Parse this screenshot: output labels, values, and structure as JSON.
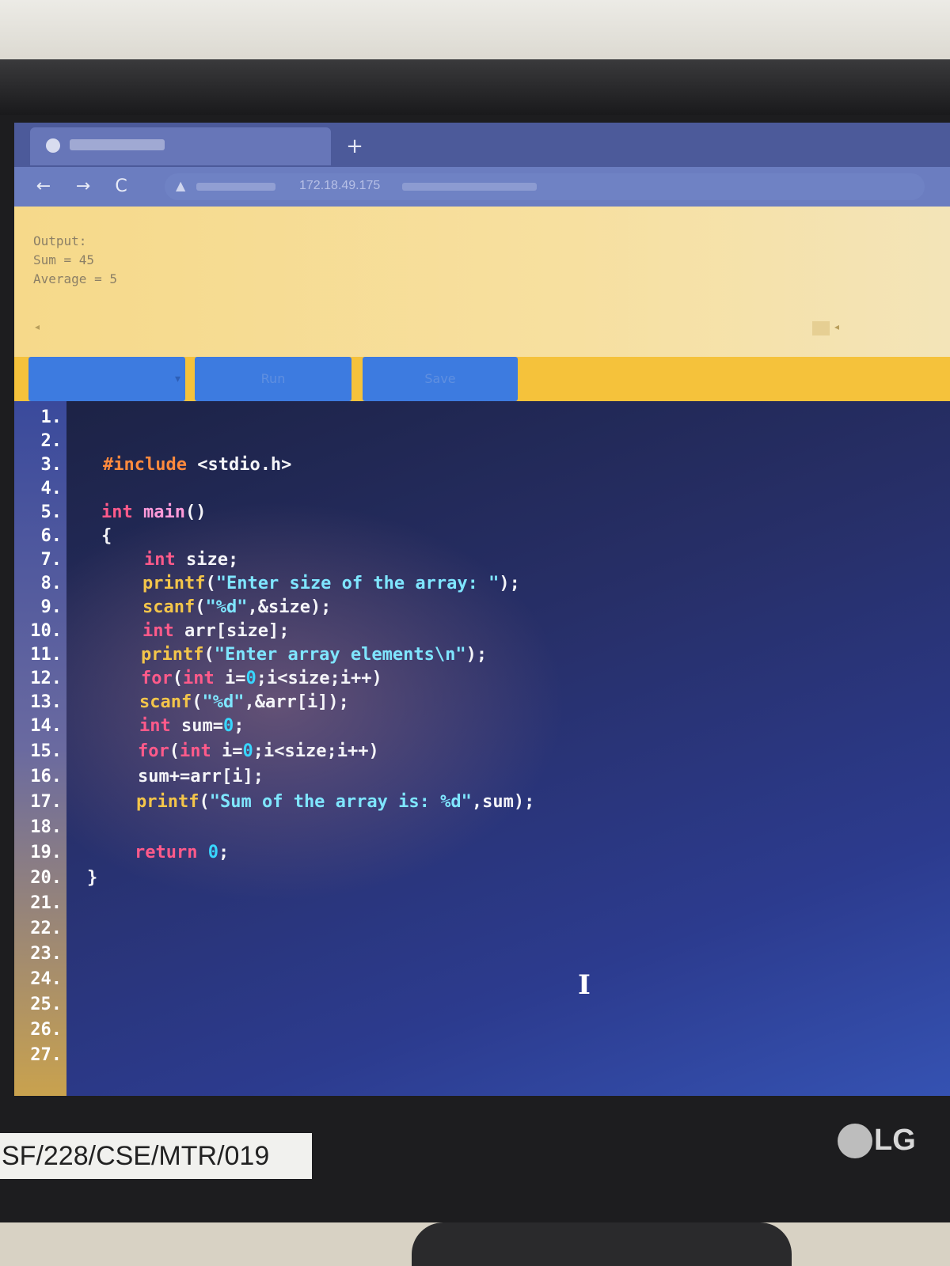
{
  "browser": {
    "new_tab_label": "+",
    "back_icon": "←",
    "forward_icon": "→",
    "reload_icon": "C",
    "warning_icon": "▲",
    "url": "172.18.49.175"
  },
  "output": {
    "lines": [
      "Output:",
      "Sum = 45",
      "Average = 5"
    ]
  },
  "controls": {
    "run_label": "Run",
    "save_label": "Save",
    "dropdown_caret": "▾"
  },
  "editor": {
    "line_numbers": [
      "1.",
      "2.",
      "3.",
      "4.",
      "5.",
      "6.",
      "7.",
      "8.",
      "9.",
      "10.",
      "11.",
      "12.",
      "13.",
      "14.",
      "15.",
      "16.",
      "17.",
      "18.",
      "19.",
      "20.",
      "21.",
      "22.",
      "23.",
      "24.",
      "25.",
      "26.",
      "27."
    ],
    "code": [
      "",
      "",
      "#include <stdio.h>",
      "",
      "int main()",
      "{",
      "int size;",
      "printf(\"Enter size of the array: \");",
      "scanf(\"%d\",&size);",
      "int arr[size];",
      "printf(\"Enter array elements\\n\");",
      "for(int i=0;i<size;i++)",
      "scanf(\"%d\",&arr[i]);",
      "int sum=0;",
      "for(int i=0;i<size;i++)",
      "sum+=arr[i];",
      "printf(\"Sum of the array is: %d\",sum);",
      "",
      "return 0;",
      "}",
      "",
      "",
      "",
      "",
      "",
      "",
      ""
    ],
    "cursor_glyph": "I"
  },
  "sticker": {
    "text": "SF/228/CSE/MTR/019"
  },
  "logo": {
    "text": "LG"
  },
  "colors": {
    "keyword": "#ff5a8a",
    "function": "#f3c54a",
    "string": "#7fe6ff",
    "number": "#38d6ff",
    "preprocessor": "#ff8a3d",
    "toolbar_blue": "#3d7be0",
    "controls_bar": "#f5c23b"
  }
}
